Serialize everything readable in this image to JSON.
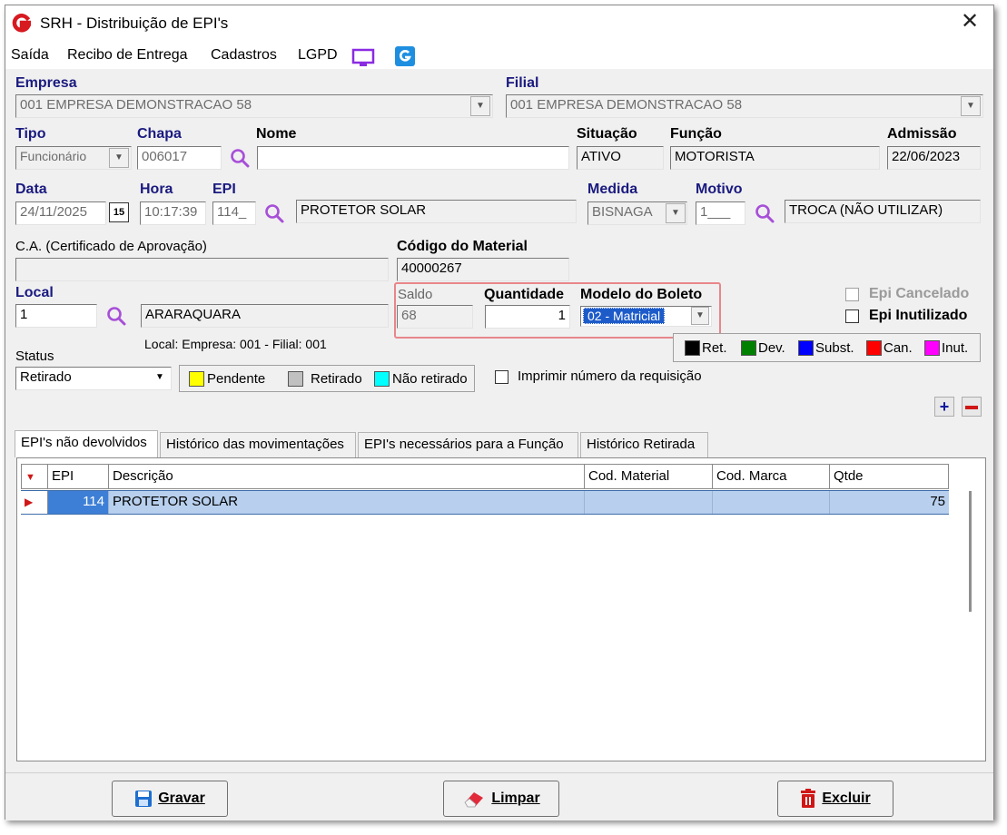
{
  "window": {
    "title": "SRH - Distribuição de EPI's"
  },
  "menu": {
    "items": [
      "Saída",
      "Recibo de Entrega",
      "Cadastros",
      "LGPD"
    ]
  },
  "form": {
    "empresa": {
      "label": "Empresa",
      "value": "001 EMPRESA DEMONSTRACAO 58"
    },
    "filial": {
      "label": "Filial",
      "value": "001 EMPRESA DEMONSTRACAO 58"
    },
    "tipo": {
      "label": "Tipo",
      "value": "Funcionário"
    },
    "chapa": {
      "label": "Chapa",
      "value": "006017"
    },
    "nome": {
      "label": "Nome",
      "value": ""
    },
    "situacao": {
      "label": "Situação",
      "value": "ATIVO"
    },
    "funcao": {
      "label": "Função",
      "value": "MOTORISTA"
    },
    "admissao": {
      "label": "Admissão",
      "value": "22/06/2023"
    },
    "data": {
      "label": "Data",
      "value": "24/11/2025",
      "cal_label": "15"
    },
    "hora": {
      "label": "Hora",
      "value": "10:17:39"
    },
    "epi": {
      "label": "EPI",
      "code": "114_",
      "desc": "PROTETOR SOLAR"
    },
    "medida": {
      "label": "Medida",
      "value": "BISNAGA"
    },
    "motivo": {
      "label": "Motivo",
      "code": "1___",
      "desc": "TROCA (NÃO UTILIZAR)"
    },
    "ca": {
      "label": "C.A. (Certificado de Aprovação)",
      "value": ""
    },
    "codigo_material": {
      "label": "Código do Material",
      "value": "40000267"
    },
    "local": {
      "label": "Local",
      "code": "1",
      "desc": "ARARAQUARA",
      "info": "Local:  Empresa: 001  -  Filial: 001"
    },
    "saldo": {
      "label": "Saldo",
      "value": "68"
    },
    "quantidade": {
      "label": "Quantidade",
      "value": "1"
    },
    "modelo_boleto": {
      "label": "Modelo do Boleto",
      "value": "02 - Matricial"
    },
    "epi_cancelado": {
      "label": "Epi Cancelado",
      "checked": false
    },
    "epi_inutilizado": {
      "label": "Epi Inutilizado",
      "checked": false
    },
    "status": {
      "label": "Status",
      "value": "Retirado"
    },
    "status_legend": [
      "Pendente",
      "Retirado",
      "Não retirado"
    ],
    "imprimir_requisicao": {
      "label": "Imprimir número da requisição",
      "checked": false
    },
    "color_legend": [
      "Ret.",
      "Dev.",
      "Subst.",
      "Can.",
      "Inut."
    ]
  },
  "colors": {
    "pendente": "#ffff00",
    "retirado": "#c0c0c0",
    "nao_retirado": "#00ffff",
    "ret": "#000000",
    "dev": "#008000",
    "subst": "#0000ff",
    "can": "#ff0000",
    "inut": "#ff00ff",
    "label_blue": "#1a1a80",
    "selection": "#b8d0ee"
  },
  "tabs": [
    "EPI's não devolvidos",
    "Histórico das movimentações",
    "EPI's necessários para a Função",
    "Histórico Retirada"
  ],
  "grid": {
    "columns": [
      "EPI",
      "Descrição",
      "Cod. Material",
      "Cod. Marca",
      "Qtde"
    ],
    "rows": [
      {
        "epi": "114",
        "descricao": "PROTETOR SOLAR",
        "cod_material": "",
        "cod_marca": "",
        "qtde": "75"
      }
    ]
  },
  "buttons": {
    "gravar": "Gravar",
    "limpar": "Limpar",
    "excluir": "Excluir"
  }
}
